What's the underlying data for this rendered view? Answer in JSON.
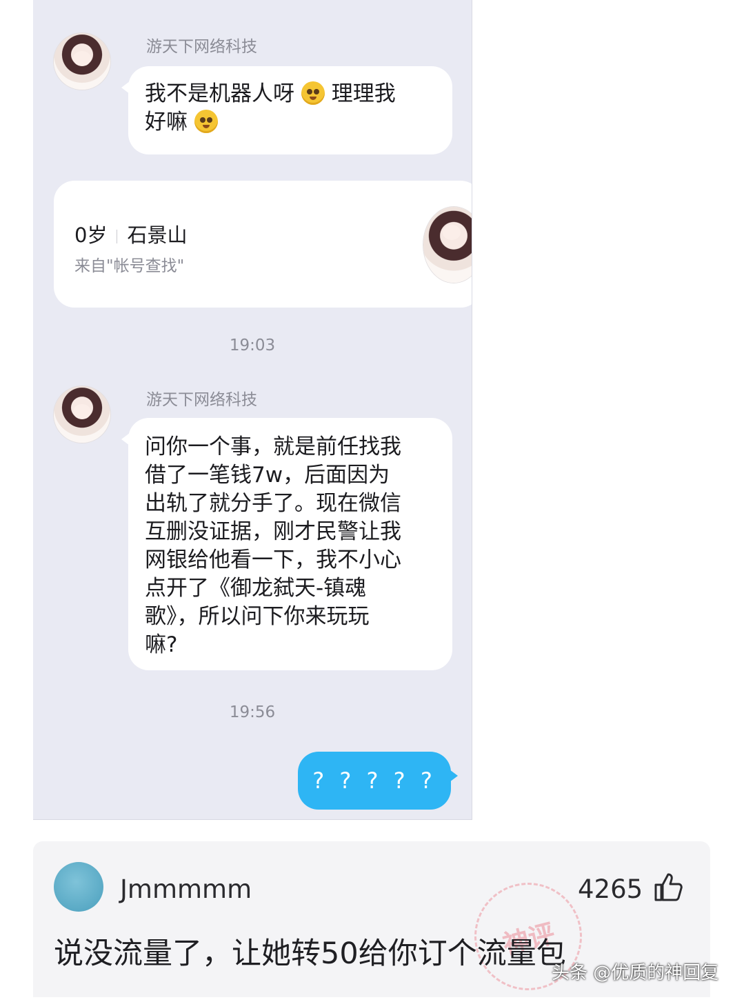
{
  "chat": {
    "messages": [
      {
        "sender": "游天下网络科技",
        "text_line1": "我不是机器人呀",
        "text_line1b": "理理我",
        "text_line2": "好嘛"
      },
      {
        "sender": "游天下网络科技",
        "lines": [
          "问你一个事，就是前任找我",
          "借了一笔钱7w，后面因为",
          "出轨了就分手了。现在微信",
          "互删没证据，刚才民警让我",
          "网银给他看一下，我不小心",
          "点开了《御龙弑天-镇魂",
          "歌》，所以问下你来玩玩",
          "嘛?"
        ]
      }
    ],
    "card": {
      "age": "0岁",
      "location": "石景山",
      "source": "来自\"帐号查找\""
    },
    "timestamps": [
      "19:03",
      "19:56"
    ],
    "outgoing": "? ? ? ? ?"
  },
  "comment": {
    "username": "Jmmmmm",
    "likes": "4265",
    "text": "说没流量了，让她转50给你订个流量包",
    "stamp": "神评"
  },
  "watermark": "头条 @优质的神回复",
  "colors": {
    "chat_bg": "#e9eaf3",
    "outgoing_bubble": "#2eb5f4",
    "comment_bg": "#f4f4f6"
  }
}
